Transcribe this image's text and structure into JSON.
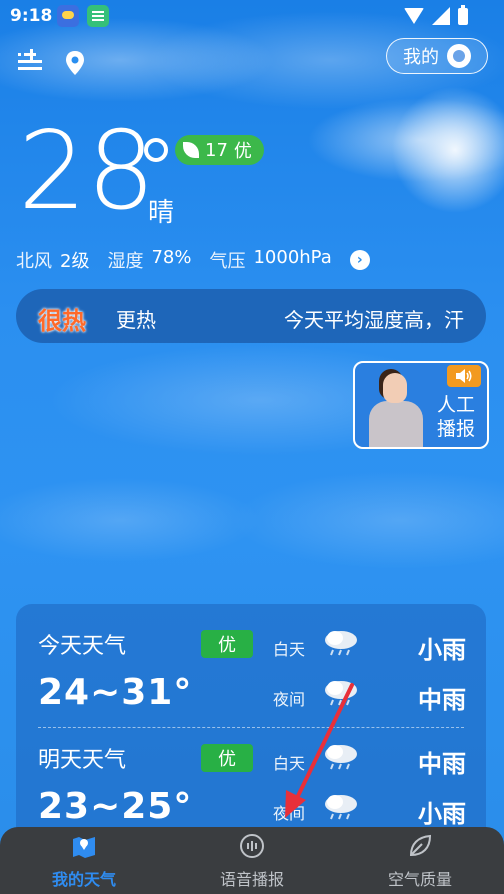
{
  "status_bar": {
    "time": "9:18"
  },
  "header": {
    "mine_label": "我的"
  },
  "current": {
    "temperature": "28",
    "condition": "晴",
    "aqi_value": "17",
    "aqi_level": "优",
    "wind_dir": "北风",
    "wind_level": "2级",
    "humidity_label": "湿度",
    "humidity_value": "78%",
    "pressure_label": "气压",
    "pressure_value": "1000hPa"
  },
  "banner": {
    "tag": "很热",
    "description": "更热",
    "marquee": "今天平均湿度高，汗"
  },
  "anchor": {
    "line1": "人工",
    "line2": "播报"
  },
  "forecast": [
    {
      "title": "今天天气",
      "range": "24~31°",
      "aqi": "优",
      "day_label": "白天",
      "day_condition": "小雨",
      "night_label": "夜间",
      "night_condition": "中雨"
    },
    {
      "title": "明天天气",
      "range": "23~25°",
      "aqi": "优",
      "day_label": "白天",
      "day_condition": "中雨",
      "night_label": "夜间",
      "night_condition": "小雨"
    }
  ],
  "tabs": [
    {
      "label": "我的天气",
      "icon": "map-icon",
      "active": true
    },
    {
      "label": "语音播报",
      "icon": "voice-icon",
      "active": false
    },
    {
      "label": "空气质量",
      "icon": "leaf-icon",
      "active": false
    }
  ],
  "colors": {
    "accent": "#2f8cf0",
    "aqi_good": "#28b045",
    "hot_tag": "#ff6a2a",
    "tabbar_bg": "#3a3d40"
  }
}
